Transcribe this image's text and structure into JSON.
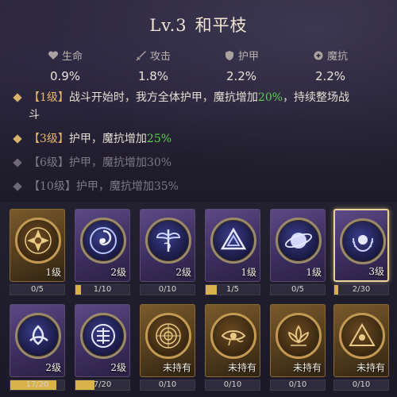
{
  "header": {
    "level": "Lv.3",
    "name": "和平枝"
  },
  "stats": [
    {
      "icon": "heart-icon",
      "label": "生命",
      "value": "0.9%"
    },
    {
      "icon": "sword-icon",
      "label": "攻击",
      "value": "1.8%"
    },
    {
      "icon": "shield-icon",
      "label": "护甲",
      "value": "2.2%"
    },
    {
      "icon": "magic-shield-icon",
      "label": "魔抗",
      "value": "2.2%"
    }
  ],
  "effects": [
    {
      "level": "【1级】",
      "text_a": "战斗开始时，我方全体护甲，魔抗增加",
      "highlight": "20%",
      "text_b": "，持续整场战",
      "text_c": "斗",
      "active": true
    },
    {
      "level": "【3级】",
      "text_a": "护甲，魔抗增加",
      "highlight": "25%",
      "text_b": "",
      "active": true
    },
    {
      "level": "【6级】",
      "text_a": "护甲，魔抗增加30%",
      "active": false
    },
    {
      "level": "【10级】",
      "text_a": "护甲，魔抗增加35%",
      "active": false
    }
  ],
  "cards": [
    {
      "label": "1级",
      "progress": "0/5",
      "progress_fraction": 0,
      "style": "gold",
      "glyph": "lotus-mandala-icon"
    },
    {
      "label": "2级",
      "progress": "1/10",
      "progress_fraction": 0.1,
      "style": "purple",
      "glyph": "vortex-icon"
    },
    {
      "label": "2级",
      "progress": "0/10",
      "progress_fraction": 0,
      "style": "purple",
      "glyph": "winged-staff-icon"
    },
    {
      "label": "1级",
      "progress": "1/5",
      "progress_fraction": 0.2,
      "style": "purple",
      "glyph": "triangle-knot-icon"
    },
    {
      "label": "1级",
      "progress": "0/5",
      "progress_fraction": 0,
      "style": "purple",
      "glyph": "orbit-sphere-icon"
    },
    {
      "label": "3级",
      "progress": "2/30",
      "progress_fraction": 0.07,
      "style": "purple",
      "selected": true,
      "glyph": "laurel-moon-icon"
    },
    {
      "label": "2级",
      "progress": "17/20",
      "progress_fraction": 0.85,
      "style": "purple",
      "glyph": "triquetra-icon"
    },
    {
      "label": "2级",
      "progress": "7/20",
      "progress_fraction": 0.35,
      "style": "purple",
      "glyph": "rune-circle-icon"
    },
    {
      "label": "未持有",
      "progress": "0/10",
      "progress_fraction": 0,
      "style": "gold",
      "glyph": "concentric-rings-icon"
    },
    {
      "label": "未持有",
      "progress": "0/10",
      "progress_fraction": 0,
      "style": "gold",
      "glyph": "eye-of-horus-icon"
    },
    {
      "label": "未持有",
      "progress": "0/10",
      "progress_fraction": 0,
      "style": "gold",
      "glyph": "lotus-flower-icon"
    },
    {
      "label": "未持有",
      "progress": "0/10",
      "progress_fraction": 0,
      "style": "gold",
      "glyph": "triangle-eye-icon"
    }
  ]
}
